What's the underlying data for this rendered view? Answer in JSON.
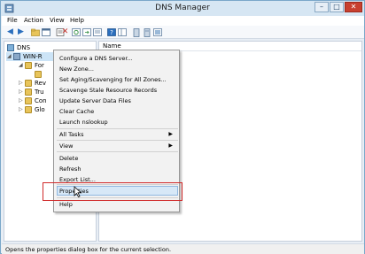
{
  "window": {
    "title": "DNS Manager"
  },
  "titlebar": {
    "min": "–",
    "max": "□",
    "close": "✕"
  },
  "menu": [
    "File",
    "Action",
    "View",
    "Help"
  ],
  "tree": {
    "root": "DNS",
    "server": "WIN-R",
    "children": [
      "For",
      "",
      "Rev",
      "Tru",
      "Con",
      "Glo"
    ]
  },
  "list": {
    "column_name": "Name"
  },
  "context_menu": {
    "items": [
      "Configure a DNS Server...",
      "New Zone...",
      "Set Aging/Scavenging for All Zones...",
      "Scavenge Stale Resource Records",
      "Update Server Data Files",
      "Clear Cache",
      "Launch nslookup",
      "All Tasks",
      "View",
      "Delete",
      "Refresh",
      "Export List...",
      "Properties",
      "Help"
    ]
  },
  "status": {
    "text": "Opens the properties dialog box for the current selection."
  },
  "colors": {
    "accent": "#2a6ebd",
    "highlight_box": "#d02a2a",
    "hover": "#d7e8f7"
  }
}
